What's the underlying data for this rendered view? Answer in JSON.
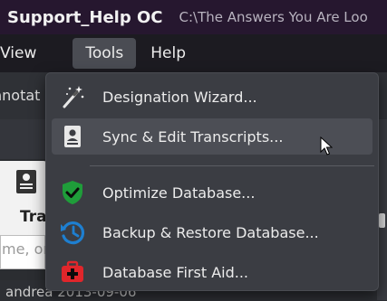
{
  "window": {
    "app_title": "Support_Help OC",
    "path": "C:\\The Answers You Are Loo"
  },
  "menubar": {
    "view_label": "View",
    "tools_label": "Tools",
    "help_label": "Help"
  },
  "background": {
    "annotate_fragment": "nnotat",
    "card_label_fragment": "Tra",
    "search_placeholder_fragment": "me, or",
    "row_fragment": "andrea 2013-09-06"
  },
  "tools_menu": {
    "items": [
      {
        "label": "Designation Wizard...",
        "icon": "magic-wand-icon"
      },
      {
        "label": "Sync & Edit Transcripts...",
        "icon": "transcript-document-icon"
      },
      {
        "label": "Optimize Database...",
        "icon": "shield-check-icon"
      },
      {
        "label": "Backup & Restore Database...",
        "icon": "history-clock-icon"
      },
      {
        "label": "Database First Aid...",
        "icon": "first-aid-kit-icon"
      }
    ],
    "hovered_index": 1
  },
  "colors": {
    "title_bar": "#26172f",
    "menu_bar": "#1c1b21",
    "menu_bg": "#3b3d43",
    "hover": "#4c4e55",
    "shield_green": "#1f9d3a",
    "history_blue": "#1e7fd0",
    "aid_red": "#e0262b"
  }
}
